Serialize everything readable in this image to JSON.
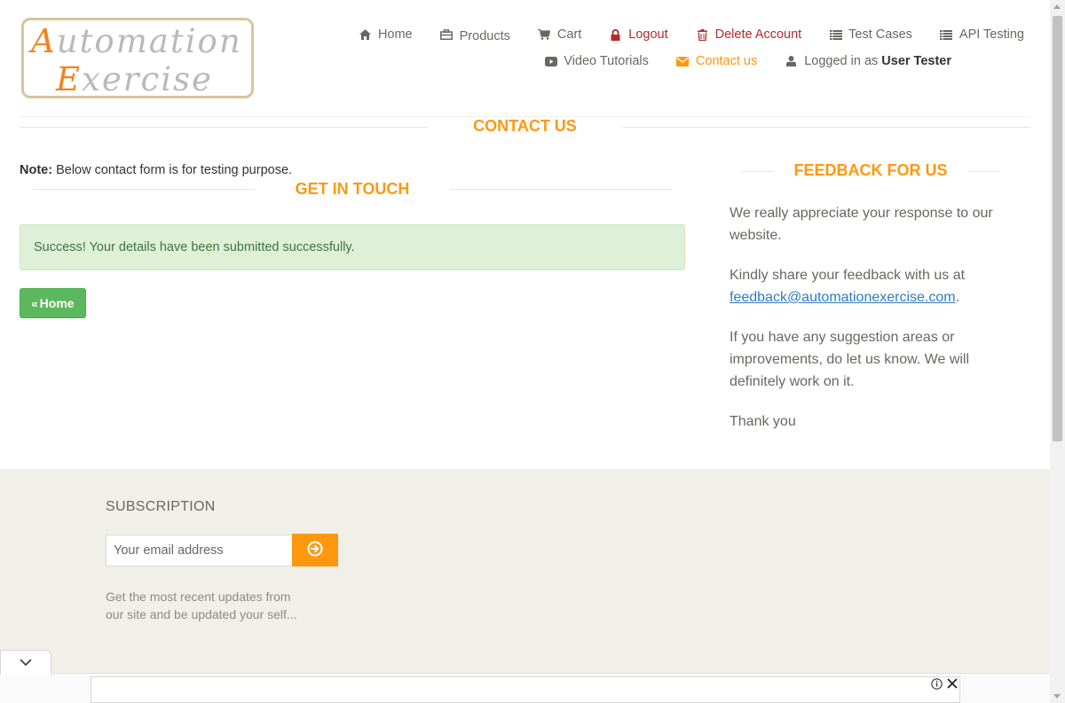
{
  "logo": {
    "line1_cap": "A",
    "line1_rest": "utomation",
    "line2_cap": "E",
    "line2_rest": "xercise"
  },
  "nav": {
    "row1": [
      {
        "label": "Home",
        "icon": "home-icon"
      },
      {
        "label": "Products",
        "icon": "products-icon"
      },
      {
        "label": "Cart",
        "icon": "cart-icon"
      },
      {
        "label": "Logout",
        "icon": "lock-icon"
      },
      {
        "label": "Delete Account",
        "icon": "trash-icon"
      },
      {
        "label": "Test Cases",
        "icon": "list-icon"
      },
      {
        "label": "API Testing",
        "icon": "list-icon"
      }
    ],
    "row2": [
      {
        "label": "Video Tutorials",
        "icon": "youtube-icon"
      },
      {
        "label": "Contact us",
        "icon": "envelope-icon"
      },
      {
        "label": "Logged in as",
        "icon": "user-icon",
        "user": "User Tester"
      }
    ]
  },
  "contact": {
    "title": "CONTACT US",
    "note_label": "Note:",
    "note_text": " Below contact form is for testing purpose.",
    "get_in_touch": "GET IN TOUCH",
    "success_message": "Success! Your details have been submitted successfully.",
    "home_button": "Home"
  },
  "feedback": {
    "title": "FEEDBACK FOR US",
    "p1": "We really appreciate your response to our website.",
    "p2_text": "Kindly share your feedback with us at ",
    "p2_email": "feedback@automationexercise.com",
    "p2_end": ".",
    "p3": "If you have any suggestion areas or improvements, do let us know. We will definitely work on it.",
    "p4": "Thank you"
  },
  "footer": {
    "subscription_title": "SUBSCRIPTION",
    "email_placeholder": "Your email address",
    "description": "Get the most recent updates from our site and be updated your self..."
  },
  "colors": {
    "accent": "#fe980f",
    "danger": "#b32b2b",
    "success_bg": "#dff0d8",
    "success_text": "#3c763d",
    "button_green": "#5cb85c",
    "footer_bg": "#f0f0e9",
    "link": "#2f7bbf"
  }
}
